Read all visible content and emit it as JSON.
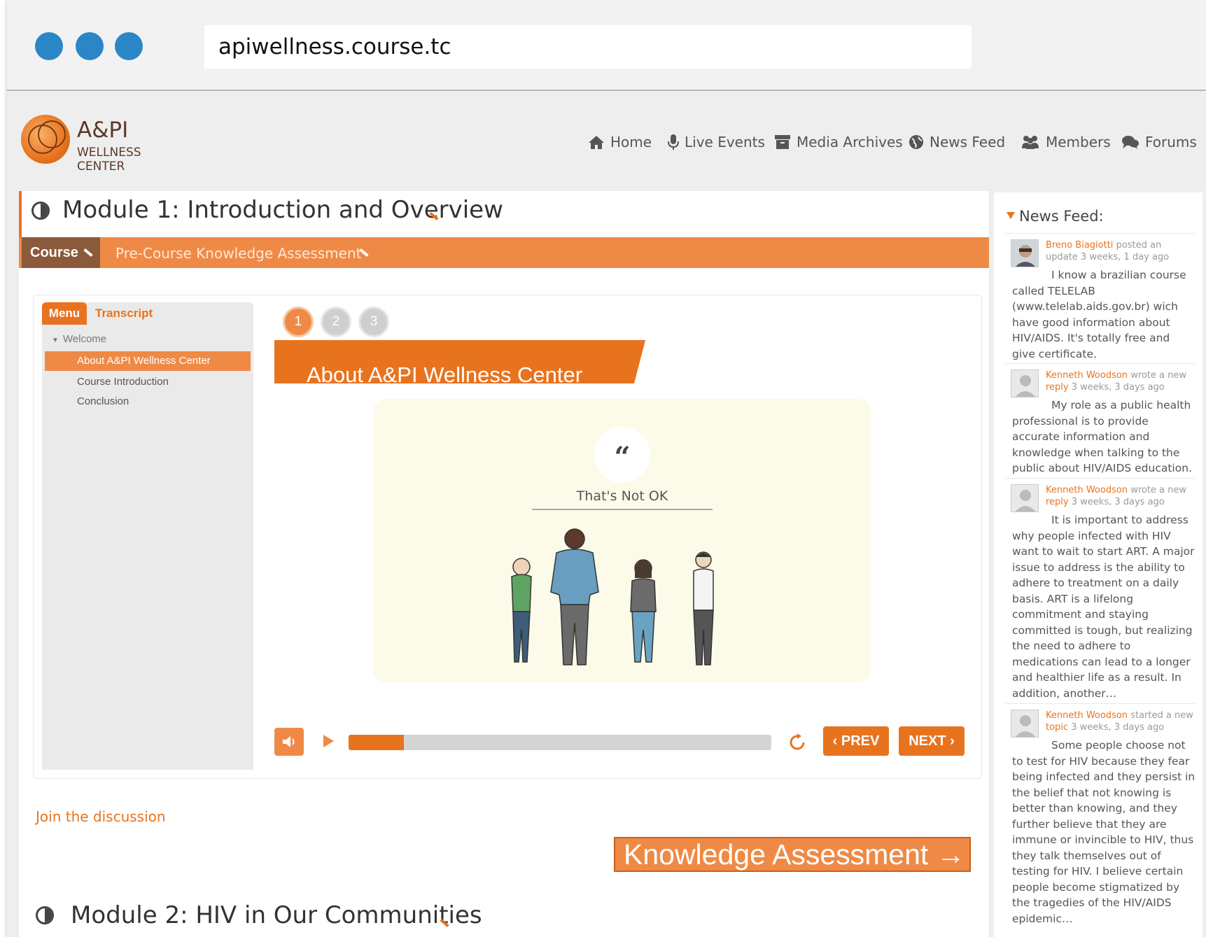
{
  "browser": {
    "url": "apiwellness.course.tc",
    "dot_color": "#2b86c8"
  },
  "logo": {
    "line1": "A&PI",
    "line2": "WELLNESS",
    "line3": "CENTER"
  },
  "nav": {
    "home": "Home",
    "live_events": "Live Events",
    "media_archives": "Media Archives",
    "news_feed": "News Feed",
    "members": "Members",
    "forums": "Forums"
  },
  "module1": {
    "title": "Module 1: Introduction and Overview",
    "course_tab": "Course",
    "precourse": "Pre-Course Knowledge Assessment"
  },
  "player": {
    "tab_menu": "Menu",
    "tab_transcript": "Transcript",
    "menu_section": "Welcome",
    "menu_items": [
      "About A&PI Wellness Center",
      "Course Introduction",
      "Conclusion"
    ],
    "active_item": "About A&PI Wellness Center",
    "steps": [
      "1",
      "2",
      "3"
    ],
    "slide_title": "About A&PI Wellness Center",
    "quote_mark": "“",
    "caption": "That's Not OK",
    "progress": 0.13,
    "prev_label": "PREV",
    "next_label": "NEXT"
  },
  "join_link": "Join the discussion",
  "ka_button": "Knowledge Assessment →",
  "module2": {
    "title": "Module 2: HIV in Our Communities"
  },
  "accent_color": "#e8731f",
  "news_feed": {
    "heading": "News Feed:",
    "items": [
      {
        "author": "Breno Biagiotti",
        "action": "posted an update",
        "time": "3 weeks, 1 day ago",
        "text": "I know a brazilian course called TELELAB (www.telelab.aids.gov.br) wich have good information about HIV/AIDS. It's totally free and give certificate."
      },
      {
        "author": "Kenneth Woodson",
        "action": "wrote a new",
        "link": "reply",
        "time": "3 weeks, 3 days ago",
        "text": "My role as a public health professional is to provide accurate information and knowledge when talking to the public about HIV/AIDS education."
      },
      {
        "author": "Kenneth Woodson",
        "action": "wrote a new",
        "link": "reply",
        "time": "3 weeks, 3 days ago",
        "text": "It is important to address why people infected with HIV want to wait to start ART. A major issue to address is the ability to adhere to treatment on a daily basis. ART is a lifelong commitment and staying committed is tough, but realizing the need to adhere to medications can lead to a longer and healthier life as a result. In addition, another…"
      },
      {
        "author": "Kenneth Woodson",
        "action": "started a new",
        "link": "topic",
        "time": "3 weeks, 3 days ago",
        "text": "Some people choose not to test for HIV because they fear being infected and they persist in the belief that not knowing is better than knowing, and they further believe that they are immune or invincible to HIV, thus they talk themselves out of testing for HIV. I believe certain people become stigmatized by the tragedies of the HIV/AIDS epidemic…"
      }
    ]
  }
}
